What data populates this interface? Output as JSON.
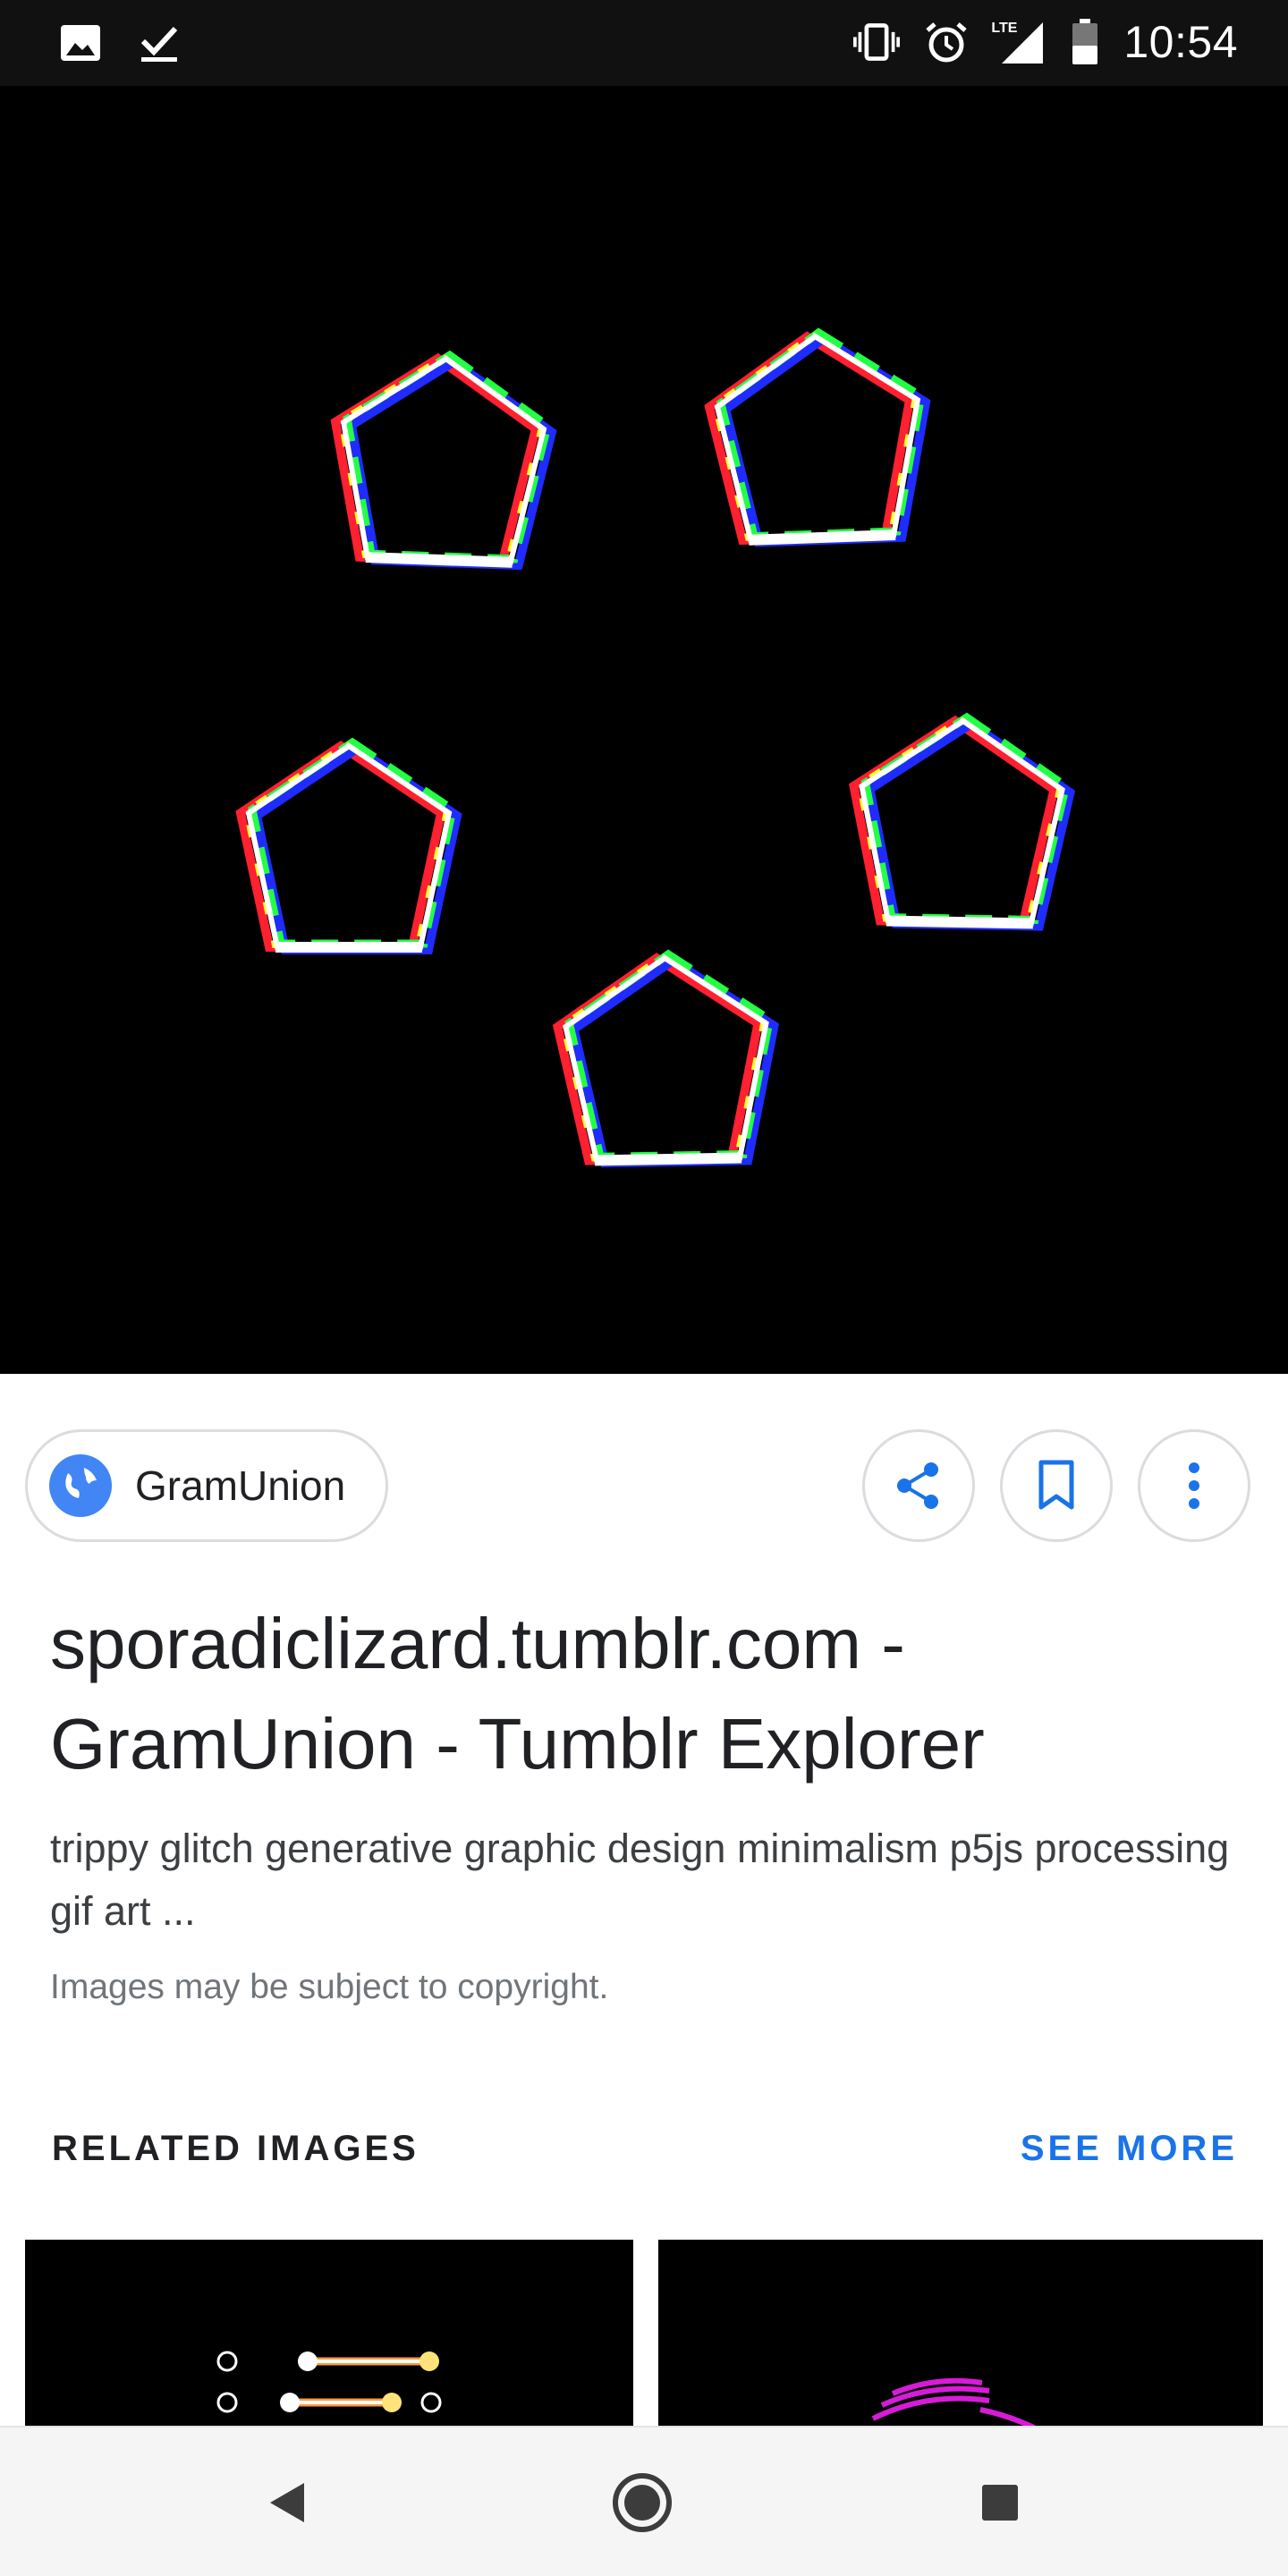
{
  "status_bar": {
    "time": "10:54",
    "left_icons": [
      "image-icon",
      "check-icon"
    ],
    "right_icons": [
      "vibrate-icon",
      "alarm-icon",
      "lte-signal-icon",
      "battery-icon"
    ],
    "network_label": "LTE"
  },
  "hero": {
    "icon": "glitch-pentagons-image"
  },
  "source": {
    "name": "GramUnion",
    "icon": "globe-icon"
  },
  "actions": {
    "share_icon": "share-icon",
    "save_icon": "bookmark-icon",
    "more_icon": "more-vert-icon"
  },
  "result": {
    "title": "sporadiclizard.tumblr.com - GramUnion - Tumblr Explorer",
    "description": "trippy glitch generative graphic design minimalism p5js processing gif art ...",
    "copyright": "Images may be subject to copyright."
  },
  "related": {
    "heading": "RELATED IMAGES",
    "see_more": "SEE MORE"
  },
  "nav": {
    "back_icon": "back-icon",
    "home_icon": "home-icon",
    "recents_icon": "recents-icon"
  },
  "colors": {
    "accent": "#1a73e8",
    "globe": "#4285f4",
    "status_bar": "#111111",
    "hero_background": "#000000"
  }
}
